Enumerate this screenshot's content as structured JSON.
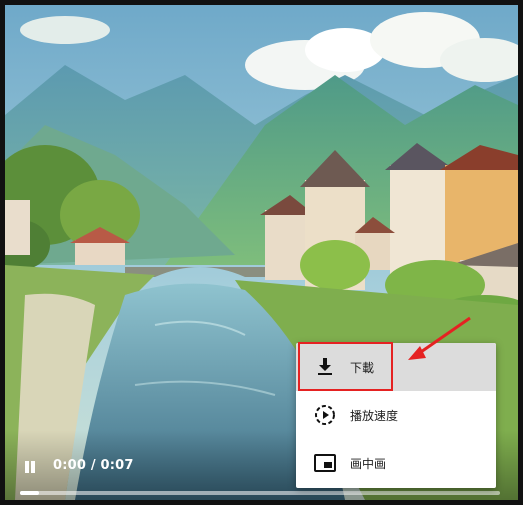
{
  "player": {
    "time_display": "0:00 / 0:07",
    "progress_fraction": 0.04,
    "playing": true
  },
  "menu": {
    "items": [
      {
        "label": "下載",
        "icon": "download-icon",
        "highlighted": true
      },
      {
        "label": "播放速度",
        "icon": "playback-speed-icon",
        "highlighted": false
      },
      {
        "label": "画中画",
        "icon": "picture-in-picture-icon",
        "highlighted": false
      }
    ]
  },
  "annotation": {
    "color": "#e52222"
  }
}
